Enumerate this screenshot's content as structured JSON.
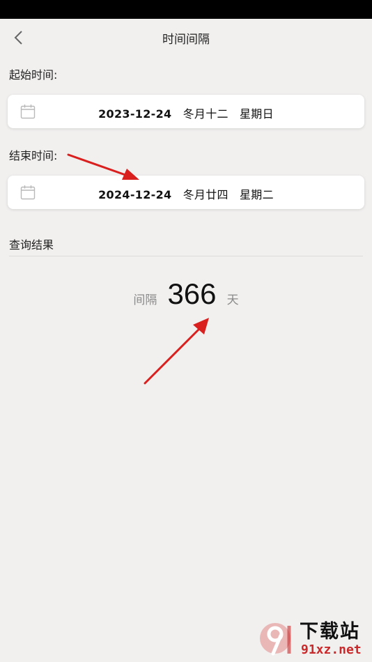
{
  "header": {
    "title": "时间间隔",
    "back_icon": "chevron-left-icon"
  },
  "start": {
    "label": "起始时间:",
    "date": "2023-12-24",
    "lunar": "冬月十二",
    "weekday": "星期日",
    "icon": "calendar-icon"
  },
  "end": {
    "label": "结束时间:",
    "date": "2024-12-24",
    "lunar": "冬月廿四",
    "weekday": "星期二",
    "icon": "calendar-icon"
  },
  "result": {
    "label": "查询结果",
    "prefix": "间隔",
    "value": "366",
    "unit": "天"
  },
  "annotations": {
    "arrow_color": "#d9201f",
    "count": 2
  },
  "watermark": {
    "title": "下载站",
    "url": "91xz.net",
    "brand_color": "#c9292a"
  }
}
